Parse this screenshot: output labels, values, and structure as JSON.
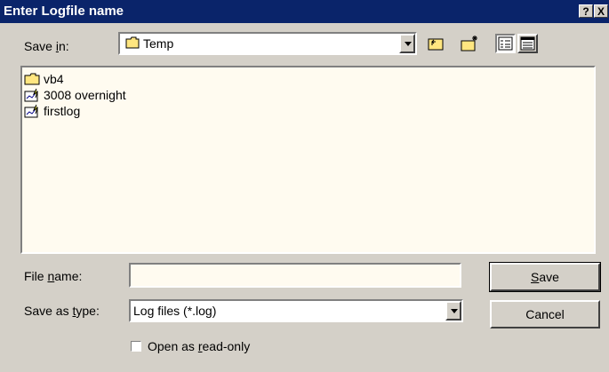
{
  "window": {
    "title": "Enter Logfile name",
    "help_label": "?",
    "close_label": "X"
  },
  "save_in": {
    "label_pre": "Save ",
    "label_u": "i",
    "label_post": "n:",
    "value": "Temp",
    "icon": "folder-icon"
  },
  "toolbar": [
    {
      "name": "up-one-level-icon",
      "tip": "Up one level"
    },
    {
      "name": "new-folder-icon",
      "tip": "Create new folder"
    },
    {
      "name": "list-view-icon",
      "tip": "List"
    },
    {
      "name": "details-view-icon",
      "tip": "Details"
    }
  ],
  "files": [
    {
      "name": "vb4",
      "type": "folder"
    },
    {
      "name": "3008 overnight",
      "type": "log"
    },
    {
      "name": "firstlog",
      "type": "log"
    }
  ],
  "file_name": {
    "label_pre": "File ",
    "label_u": "n",
    "label_post": "ame:",
    "value": ""
  },
  "save_as_type": {
    "label_pre": "Save as ",
    "label_u": "t",
    "label_post": "ype:",
    "value": "Log files (*.log)"
  },
  "buttons": {
    "save_u": "S",
    "save_rest": "ave",
    "cancel": "Cancel"
  },
  "readonly": {
    "label_pre": "Open as ",
    "label_u": "r",
    "label_post": "ead-only",
    "checked": false
  }
}
